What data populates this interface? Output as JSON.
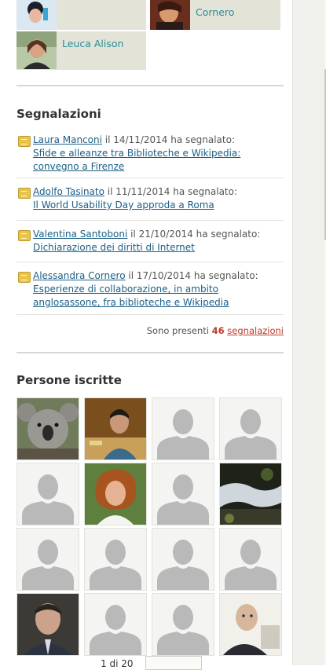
{
  "members_top": [
    {
      "name": ""
    },
    {
      "name": "Cornero"
    },
    {
      "name": "Leuca Alison"
    }
  ],
  "segnalazioni": {
    "title": "Segnalazioni",
    "items": [
      {
        "user": "Laura Manconi",
        "mid": "il 14/11/2014 ha segnalato:",
        "title": "Sfide e alleanze tra Biblioteche e Wikipedia: convegno a Firenze"
      },
      {
        "user": "Adolfo Tasinato",
        "mid": "il 11/11/2014 ha segnalato:",
        "title": "Il World Usability Day approda a Roma"
      },
      {
        "user": "Valentina Santoboni",
        "mid": "il 21/10/2014 ha segnalato:",
        "title": "Dichiarazione dei diritti di Internet"
      },
      {
        "user": "Alessandra Cornero",
        "mid": "il 17/10/2014 ha segnalato:",
        "title": "Esperienze di collaborazione, in ambito anglosassone, fra biblioteche e Wikipedia"
      }
    ],
    "total_prefix": "Sono presenti",
    "total_count": "46",
    "total_suffix": "segnalazioni"
  },
  "persone": {
    "title": "Persone iscritte",
    "avatars": [
      "koala",
      "man-photo",
      "placeholder",
      "placeholder",
      "placeholder",
      "woman-photo",
      "placeholder",
      "waterfall-photo",
      "placeholder",
      "placeholder",
      "placeholder",
      "placeholder",
      "man-photo-2",
      "placeholder",
      "placeholder",
      "bald-man-photo"
    ],
    "pager": "1 di 20"
  },
  "colors": {
    "accent": "#2a8d96",
    "link": "#1a5f86",
    "count": "#c0392b"
  }
}
